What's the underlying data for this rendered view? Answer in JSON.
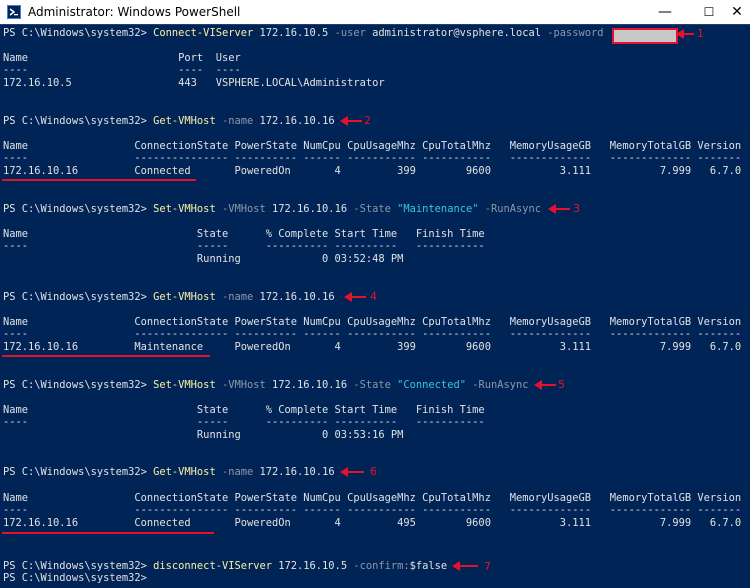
{
  "window": {
    "title": "Administrator: Windows PowerShell",
    "minimize": "—",
    "maximize": "☐",
    "close": "✕"
  },
  "console": {
    "c1": {
      "prompt": "PS C:\\Windows\\system32> ",
      "cmd": "Connect-VIServer",
      "a1": " 172.16.10.5 ",
      "p1": "-user",
      "a2": " administrator@vsphere.local ",
      "p2": "-password"
    },
    "t1": {
      "header": "Name                        Port  User",
      "dashes": "----                        ----  ----",
      "row": "172.16.10.5                 443   VSPHERE.LOCAL\\Administrator"
    },
    "c2": {
      "prompt": "PS C:\\Windows\\system32> ",
      "cmd": "Get-VMHost",
      "p1": " -name",
      "a1": " 172.16.10.16"
    },
    "hostHeader": "Name                 ConnectionState PowerState NumCpu CpuUsageMhz CpuTotalMhz   MemoryUsageGB   MemoryTotalGB Version",
    "hostDashes": "----                 --------------- ---------- ------ ----------- -----------   -------------   ------------- -------",
    "t2row": "172.16.10.16         Connected       PoweredOn       4         399        9600           3.111           7.999   6.7.0",
    "c3": {
      "prompt": "PS C:\\Windows\\system32> ",
      "cmd": "Set-VMHost",
      "p1": " -VMHost",
      "a1": " 172.16.10.16 ",
      "p2": "-State",
      "s1": " \"Maintenance\"",
      "p3": " -RunAsync"
    },
    "taskHeader": "Name                           State      % Complete Start Time   Finish Time",
    "taskDashes": "----                           -----      ---------- ----------   -----------",
    "t3row": "                               Running             0 03:52:48 PM",
    "c4": {
      "prompt": "PS C:\\Windows\\system32> ",
      "cmd": "Get-VMHost",
      "p1": " -name",
      "a1": " 172.16.10.16"
    },
    "t4row": "172.16.10.16         Maintenance     PoweredOn       4         399        9600           3.111           7.999   6.7.0",
    "c5": {
      "prompt": "PS C:\\Windows\\system32> ",
      "cmd": "Set-VMHost",
      "p1": " -VMHost",
      "a1": " 172.16.10.16 ",
      "p2": "-State",
      "s1": " \"Connected\"",
      "p3": " -RunAsync"
    },
    "t5row": "                               Running             0 03:53:16 PM",
    "c6": {
      "prompt": "PS C:\\Windows\\system32> ",
      "cmd": "Get-VMHost",
      "p1": " -name",
      "a1": " 172.16.10.16"
    },
    "t6row": "172.16.10.16         Connected       PoweredOn       4         495        9600           3.111           7.999   6.7.0",
    "c7": {
      "prompt": "PS C:\\Windows\\system32> ",
      "cmd": "disconnect-VIServer",
      "a1": " 172.16.10.5 ",
      "p1": "-confirm:",
      "v1": "$false"
    },
    "finalPrompt": "PS C:\\Windows\\system32>"
  },
  "annotations": [
    "1",
    "2",
    "3",
    "4",
    "5",
    "6",
    "7"
  ],
  "colors": {
    "console_bg": "#012456",
    "command": "#f9f1a5",
    "parameter": "#8d97a8",
    "string": "#3ac7d6",
    "annotation": "#e8112d"
  }
}
